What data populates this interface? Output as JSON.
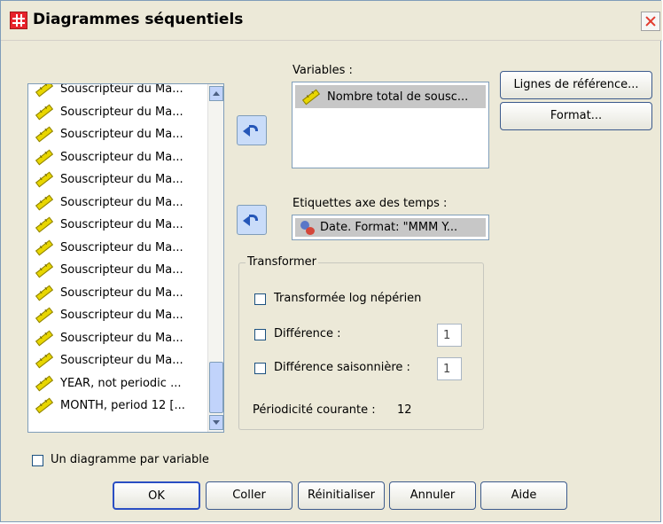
{
  "window": {
    "title": "Diagrammes séquentiels"
  },
  "var_list": {
    "items": [
      "Souscripteur du Ma...",
      "Souscripteur du Ma...",
      "Souscripteur du Ma...",
      "Souscripteur du Ma...",
      "Souscripteur du Ma...",
      "Souscripteur du Ma...",
      "Souscripteur du Ma...",
      "Souscripteur du Ma...",
      "Souscripteur du Ma...",
      "Souscripteur du Ma...",
      "Souscripteur du Ma...",
      "Souscripteur du Ma...",
      "Souscripteur du Ma...",
      "YEAR, not periodic ...",
      "MONTH, period 12 [..."
    ]
  },
  "variables": {
    "label": "Variables :",
    "selected": "Nombre total de sousc..."
  },
  "time_axis": {
    "label": "Etiquettes axe des temps :",
    "selected": "Date.  Format:  \"MMM Y..."
  },
  "transform": {
    "group_label": "Transformer",
    "log_label": "Transformée log népérien",
    "diff_label": "Différence :",
    "diff_value": "1",
    "seasonal_label": "Différence saisonnière :",
    "seasonal_value": "1",
    "periodicity_label": "Périodicité courante :",
    "periodicity_value": "12"
  },
  "side_buttons": {
    "ref_lines": "Lignes de référence...",
    "format": "Format..."
  },
  "one_chart_label": "Un diagramme par variable",
  "buttons": {
    "ok": "OK",
    "paste": "Coller",
    "reset": "Réinitialiser",
    "cancel": "Annuler",
    "help": "Aide"
  }
}
